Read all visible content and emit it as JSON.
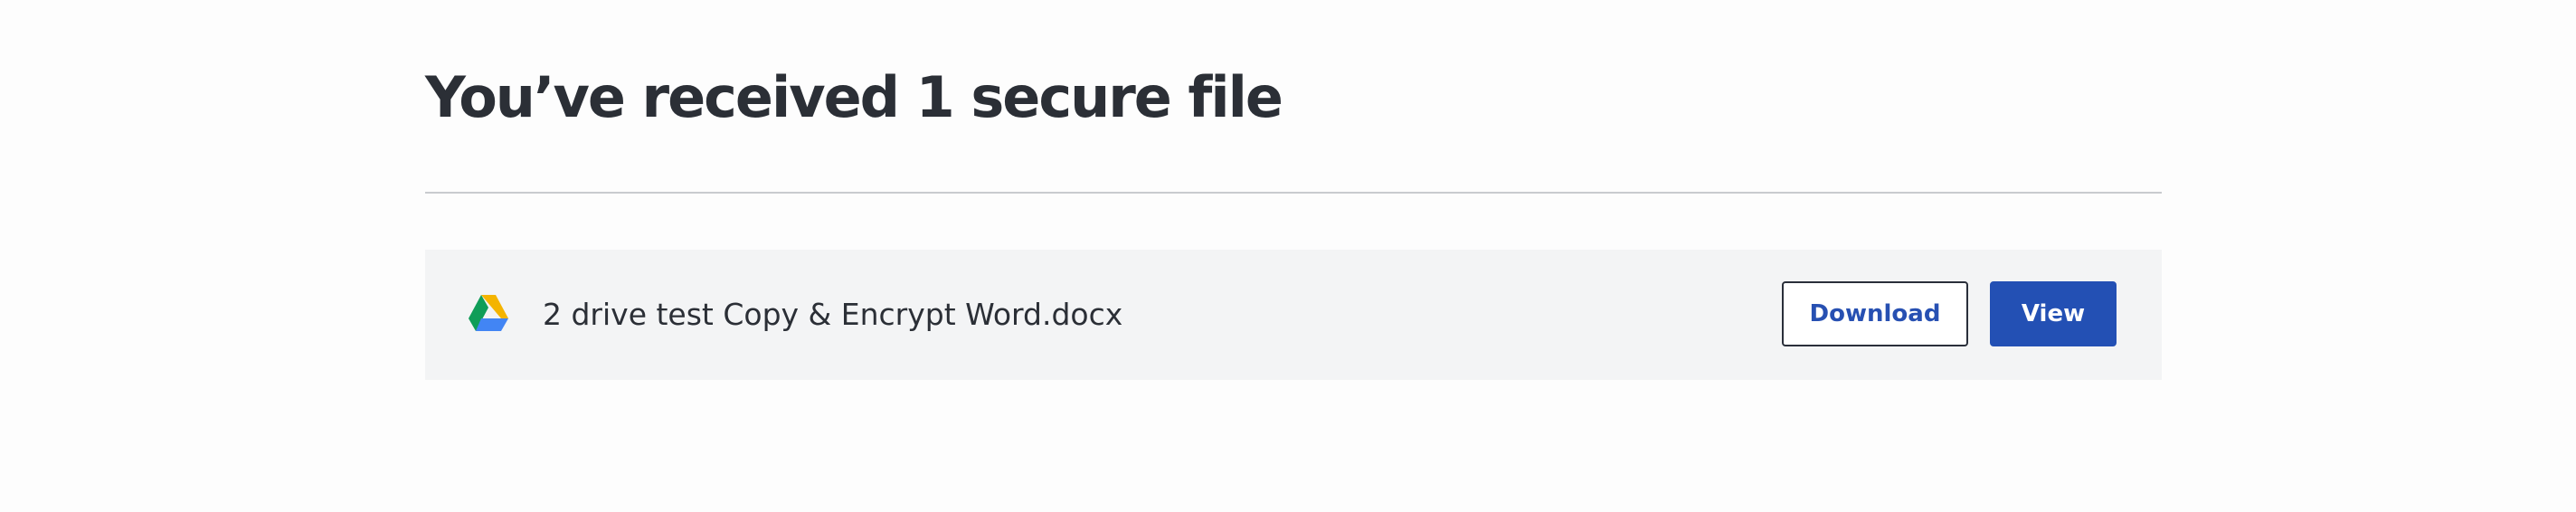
{
  "header": {
    "title": "You’ve received 1 secure file"
  },
  "files": [
    {
      "icon": "google-drive-icon",
      "name": "2 drive test Copy & Encrypt Word.docx",
      "download_label": "Download",
      "view_label": "View"
    }
  ],
  "colors": {
    "primary": "#2350b4",
    "row_background": "#f3f4f5",
    "divider": "#c9cbcf",
    "text": "#2b2f36"
  }
}
